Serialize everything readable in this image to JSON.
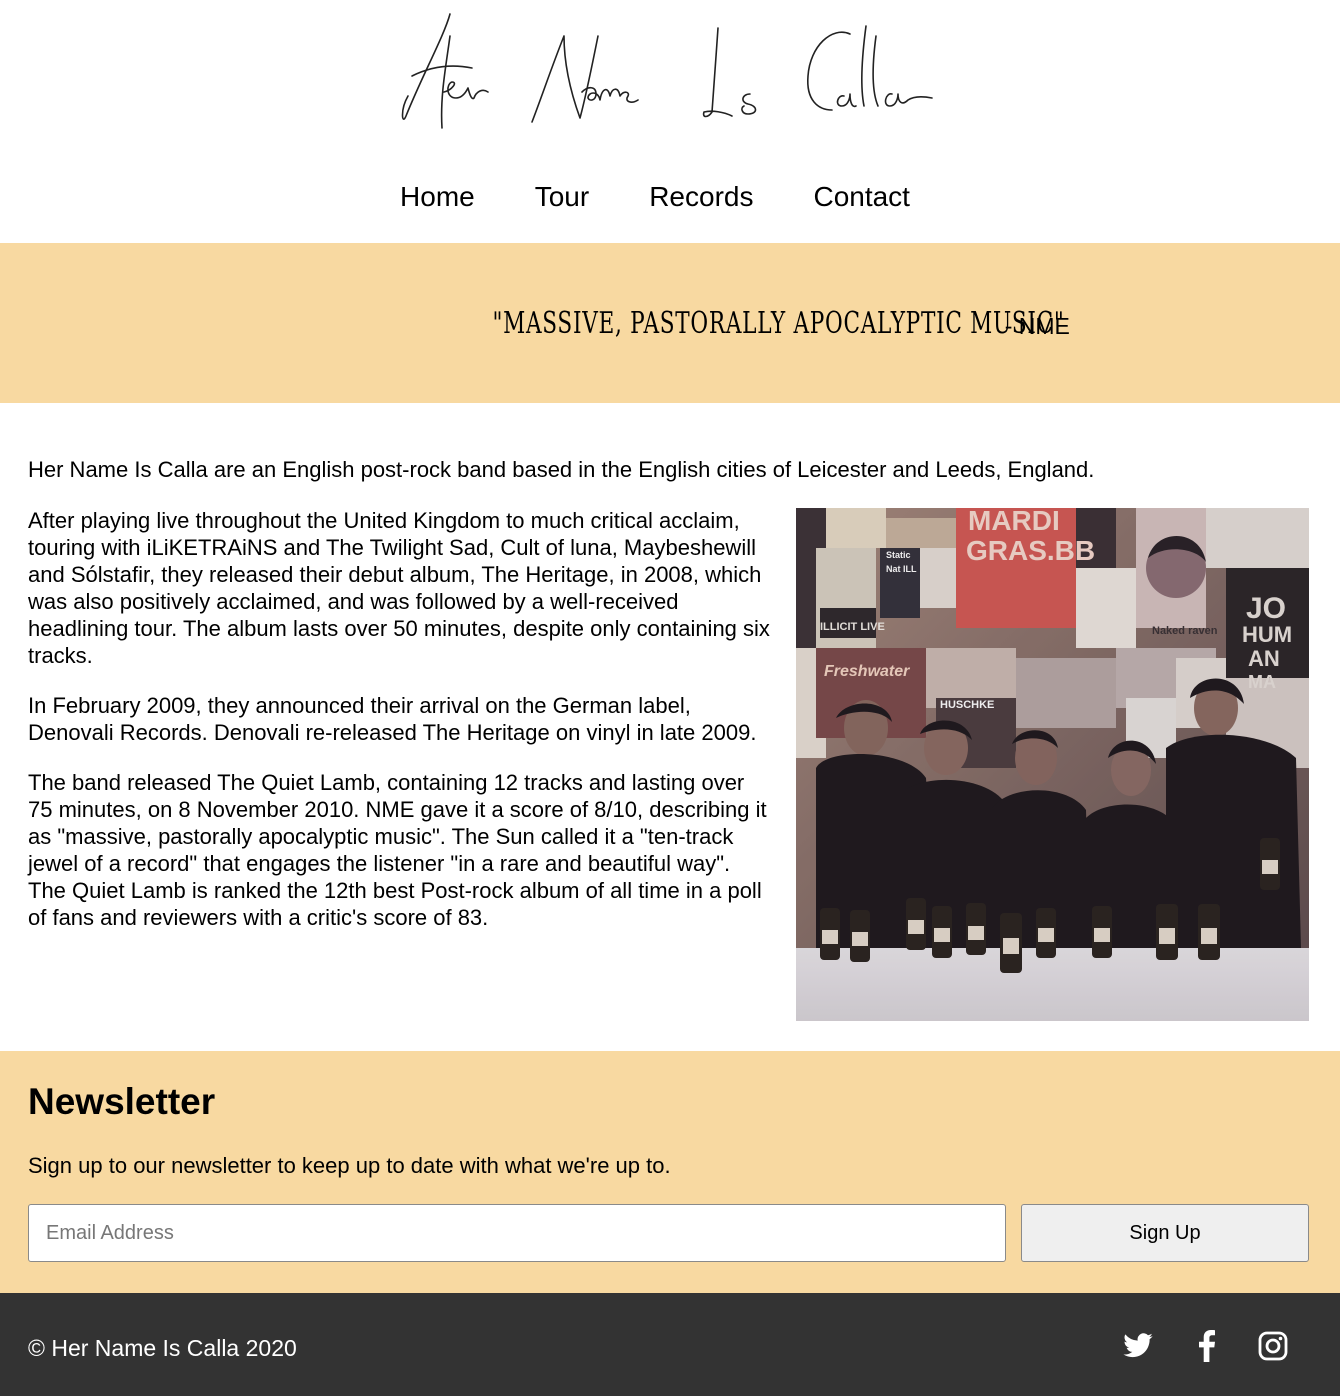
{
  "header": {
    "logo_text": "Her Name Is Calla",
    "nav": [
      {
        "label": "Home"
      },
      {
        "label": "Tour"
      },
      {
        "label": "Records"
      },
      {
        "label": "Contact"
      }
    ]
  },
  "quote": {
    "text": "\"MASSIVE, PASTORALLY APOCALYPTIC MUSIC\"",
    "source": "- NME"
  },
  "main": {
    "intro": "Her Name Is Calla are an English post-rock band based in the English cities of Leicester and Leeds, England.",
    "paragraphs": [
      "After playing live throughout the United Kingdom to much critical acclaim, touring with iLiKETRAiNS and The Twilight Sad, Cult of luna, Maybeshewill and Sólstafir, they released their debut album, The Heritage, in 2008, which was also positively acclaimed, and was followed by a well-received headlining tour. The album lasts over 50 minutes, despite only containing six tracks.",
      "In February 2009, they announced their arrival on the German label, Denovali Records. Denovali re-released The Heritage on vinyl in late 2009.",
      "The band released The Quiet Lamb, containing 12 tracks and lasting over 75 minutes, on 8 November 2010. NME gave it a score of 8/10, describing it as \"massive, pastorally apocalyptic music\". The Sun called it a \"ten-track jewel of a record\" that engages the listener \"in a rare and beautiful way\". The Quiet Lamb is ranked the 12th best Post-rock album of all time in a poll of fans and reviewers with a critic's score of 83."
    ],
    "photo_poster_text": [
      "MARDI",
      "GRAS.BB",
      "ILLICIT LIVE",
      "Static",
      "Nat ILL",
      "Freshwater",
      "HUSCHKE",
      "Naked raven",
      "JO",
      "HUM",
      "AN",
      "MA"
    ]
  },
  "newsletter": {
    "heading": "Newsletter",
    "description": "Sign up to our newsletter to keep up to date with what we're up to.",
    "email_placeholder": "Email Address",
    "button_label": "Sign Up"
  },
  "footer": {
    "copyright": "© Her Name Is Calla 2020",
    "social": [
      "twitter-icon",
      "facebook-icon",
      "instagram-icon"
    ]
  },
  "colors": {
    "band": "#f8d9a1",
    "footer": "#333333"
  }
}
